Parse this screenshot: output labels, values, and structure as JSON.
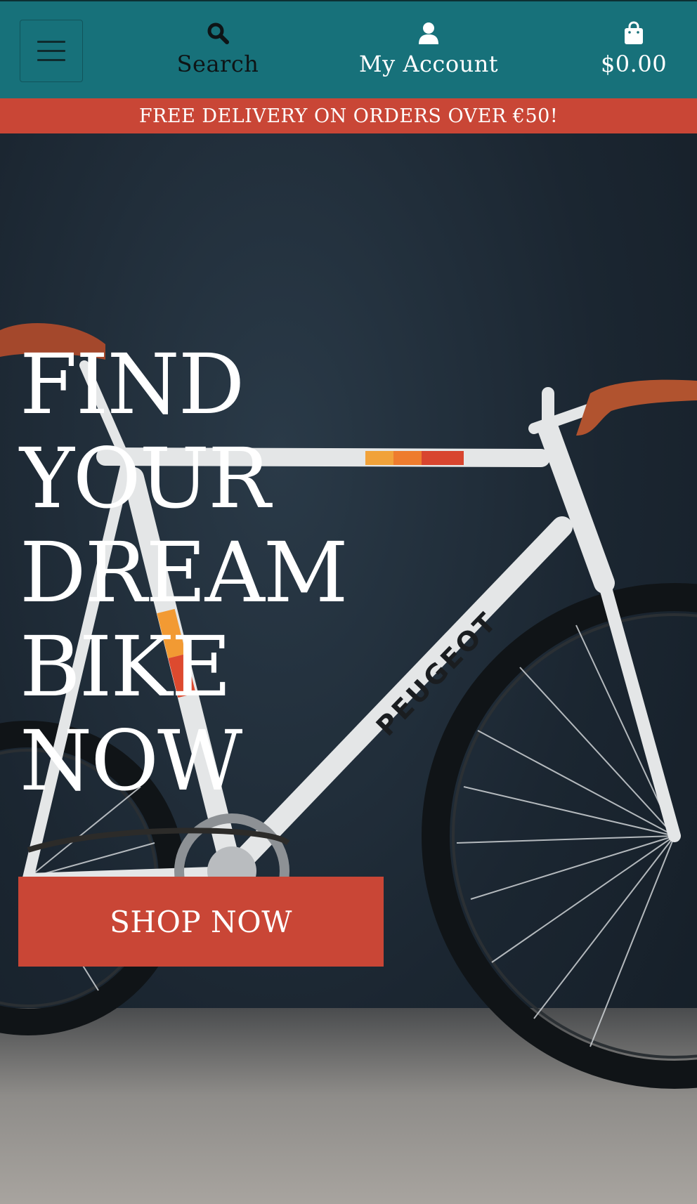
{
  "header": {
    "menu_icon": "hamburger-menu-icon",
    "search": {
      "icon": "search-icon",
      "label": "Search"
    },
    "account": {
      "icon": "user-icon",
      "label": "My Account"
    },
    "cart": {
      "icon": "shopping-bag-icon",
      "label": "$0.00"
    }
  },
  "promo": {
    "text": "FREE DELIVERY ON ORDERS OVER €50!"
  },
  "hero": {
    "headline_lines": [
      "FIND",
      "YOUR",
      "DREAM",
      "BIKE",
      "NOW"
    ],
    "bike_brand": "PEUGEOT",
    "cta_label": "SHOP NOW"
  },
  "colors": {
    "header_bg": "#17717a",
    "accent": "#c94636",
    "hero_bg": "#1b2631",
    "text_light": "#ffffff",
    "text_dark": "#0e1416"
  }
}
